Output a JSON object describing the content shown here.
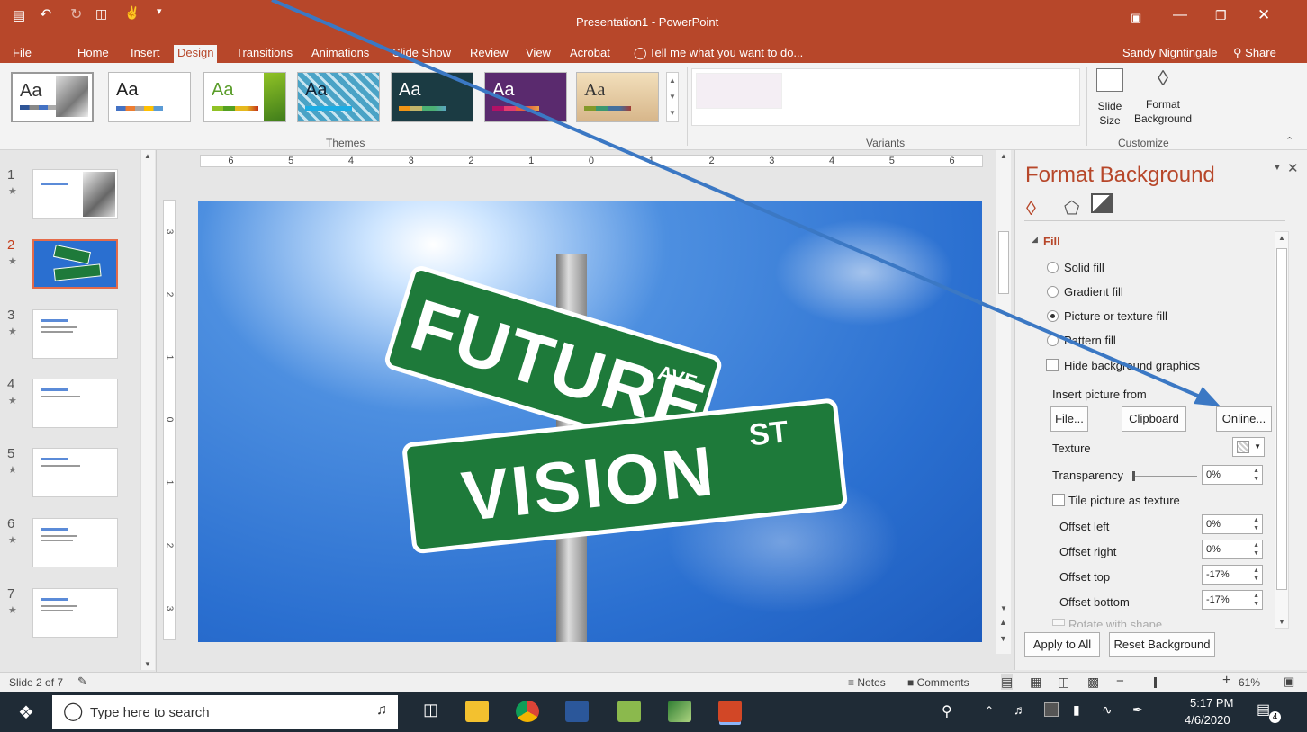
{
  "titlebar": {
    "title": "Presentation1 - PowerPoint",
    "user": "Sandy Nigntingale",
    "share": "Share"
  },
  "tabs": [
    "File",
    "Home",
    "Insert",
    "Design",
    "Transitions",
    "Animations",
    "Slide Show",
    "Review",
    "View",
    "Acrobat"
  ],
  "tell_me": "Tell me what you want to do...",
  "ribbon": {
    "themes_label": "Themes",
    "variants_label": "Variants",
    "customize_label": "Customize",
    "slide_size_label": "Slide Size",
    "format_bg_label": "Format Background",
    "theme_sample": "Aa"
  },
  "slides": {
    "numbers": [
      "1",
      "2",
      "3",
      "4",
      "5",
      "6",
      "7"
    ],
    "selected": 2
  },
  "slide_content": {
    "sign_top": "FUTURE",
    "sign_top_suffix": "AVE",
    "sign_bottom": "VISION",
    "sign_bottom_suffix": "ST"
  },
  "ruler": {
    "h": [
      "6",
      "5",
      "4",
      "3",
      "2",
      "1",
      "0",
      "1",
      "2",
      "3",
      "4",
      "5",
      "6"
    ],
    "v": [
      "3",
      "2",
      "1",
      "0",
      "1",
      "2",
      "3"
    ]
  },
  "format_pane": {
    "title": "Format Background",
    "section": "Fill",
    "options": [
      "Solid fill",
      "Gradient fill",
      "Picture or texture fill",
      "Pattern fill"
    ],
    "selected_option": "Picture or texture fill",
    "hide_bg": "Hide background graphics",
    "insert_from": "Insert picture from",
    "btn_file": "File...",
    "btn_clipboard": "Clipboard",
    "btn_online": "Online...",
    "texture": "Texture",
    "transparency_label": "Transparency",
    "transparency_value": "0%",
    "tile": "Tile picture as texture",
    "offsets": [
      {
        "label": "Offset left",
        "value": "0%"
      },
      {
        "label": "Offset right",
        "value": "0%"
      },
      {
        "label": "Offset top",
        "value": "-17%"
      },
      {
        "label": "Offset bottom",
        "value": "-17%"
      }
    ],
    "rotate": "Rotate with shape",
    "apply_all": "Apply to All",
    "reset": "Reset Background"
  },
  "status": {
    "slide_info": "Slide 2 of 7",
    "notes": "Notes",
    "comments": "Comments",
    "zoom": "61%"
  },
  "taskbar": {
    "search": "Type here to search",
    "time": "5:17 PM",
    "date": "4/6/2020",
    "notifications": "4"
  },
  "colors": {
    "accent": "#b7472a",
    "arrow": "#3b78c4",
    "sign_green": "#1e7a3a",
    "sky": "#2a6fd0"
  }
}
